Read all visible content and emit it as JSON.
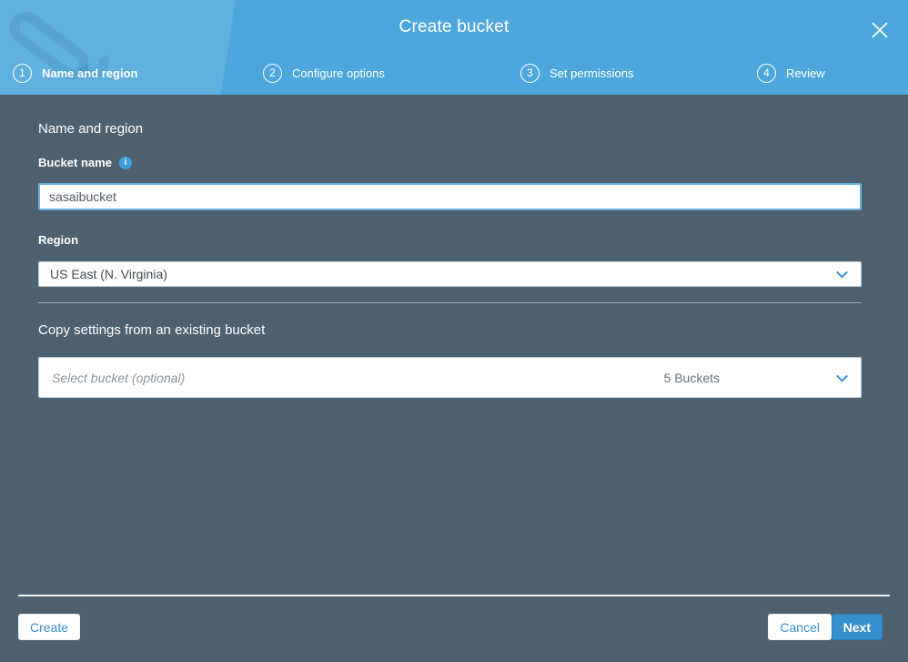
{
  "modal": {
    "title": "Create bucket"
  },
  "steps": [
    {
      "number": "1",
      "label": "Name and region"
    },
    {
      "number": "2",
      "label": "Configure options"
    },
    {
      "number": "3",
      "label": "Set permissions"
    },
    {
      "number": "4",
      "label": "Review"
    }
  ],
  "form": {
    "section_title": "Name and region",
    "bucket_name_label": "Bucket name",
    "bucket_name_value": "sasaibucket",
    "info_icon_glyph": "i",
    "region_label": "Region",
    "region_value": "US East (N. Virginia)",
    "copy_settings_title": "Copy settings from an existing bucket",
    "copy_settings_placeholder": "Select bucket (optional)",
    "copy_settings_count": "5 Buckets"
  },
  "footer": {
    "create_label": "Create",
    "cancel_label": "Cancel",
    "next_label": "Next"
  },
  "colors": {
    "header_blue": "#4ea7dc",
    "body_slate": "#4d6170",
    "accent_blue": "#3790cd",
    "focus_border_blue": "#64b1e2"
  }
}
